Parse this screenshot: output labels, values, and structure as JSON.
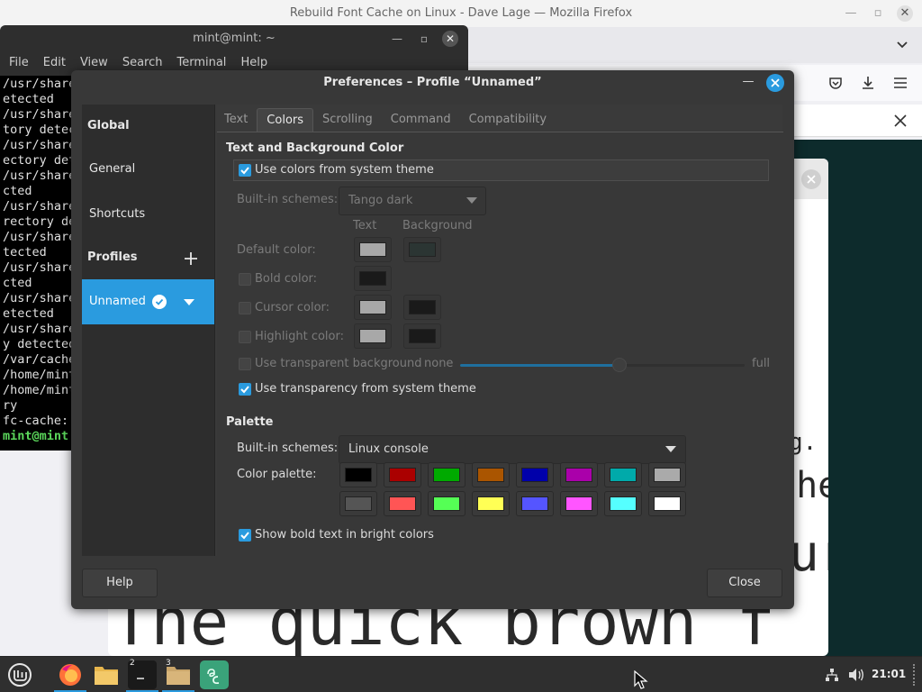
{
  "firefox": {
    "title": "Rebuild Font Cache on Linux - Dave Lage — Mozilla Firefox",
    "preview_lines": [
      "g.",
      "che",
      "ur",
      "The quick brown f"
    ]
  },
  "terminal": {
    "title": "mint@mint: ~",
    "menu": [
      "File",
      "Edit",
      "View",
      "Search",
      "Terminal",
      "Help"
    ],
    "lines": [
      "/usr/share",
      "etected",
      "/usr/share",
      "tory detec",
      "/usr/share",
      "ectory det",
      "/usr/share",
      "cted",
      "/usr/share",
      "rectory de",
      "/usr/share",
      "tected",
      "/usr/share",
      "cted",
      "/usr/share",
      "etected",
      "/usr/share",
      "y detected",
      "/var/cache",
      "/home/mint",
      "/home/mint",
      "ry",
      "fc-cache: "
    ],
    "prompt": "mint@mint"
  },
  "dialog": {
    "title": "Preferences – Profile “Unnamed”",
    "sidebar": {
      "global": "Global",
      "general": "General",
      "shortcuts": "Shortcuts",
      "profiles": "Profiles",
      "profile_name": "Unnamed"
    },
    "tabs": [
      "Text",
      "Colors",
      "Scrolling",
      "Command",
      "Compatibility"
    ],
    "active_tab": "Colors",
    "text_bg": {
      "heading": "Text and Background Color",
      "use_system_theme": "Use colors from system theme",
      "use_system_theme_checked": true,
      "builtin_label": "Built-in schemes:",
      "builtin_value": "Tango dark",
      "col_text": "Text",
      "col_background": "Background",
      "default_color": "Default color:",
      "bold_color": "Bold color:",
      "cursor_color": "Cursor color:",
      "highlight_color": "Highlight color:",
      "transparent_bg": "Use transparent background",
      "none": "none",
      "full": "full",
      "transparency_level": 0.56,
      "use_transparency_system": "Use transparency from system theme",
      "use_transparency_system_checked": true,
      "swatches": {
        "default_text": "#a8a8a8",
        "default_bg": "#2b3533",
        "bold_text": "#1a1a1a",
        "cursor_text": "#a8a8a8",
        "cursor_bg": "#1a1a1a",
        "highlight_text": "#a8a8a8",
        "highlight_bg": "#1a1a1a"
      }
    },
    "palette": {
      "heading": "Palette",
      "builtin_label": "Built-in schemes:",
      "builtin_value": "Linux console",
      "color_palette_label": "Color palette:",
      "row1": [
        "#000000",
        "#aa0000",
        "#00aa00",
        "#aa5500",
        "#0000aa",
        "#aa00aa",
        "#00aaaa",
        "#aaaaaa"
      ],
      "row2": [
        "#555555",
        "#ff5555",
        "#55ff55",
        "#ffff55",
        "#5555ff",
        "#ff55ff",
        "#55ffff",
        "#ffffff"
      ],
      "bold_bright": "Show bold text in bright colors",
      "bold_bright_checked": true
    },
    "buttons": {
      "help": "Help",
      "close": "Close"
    },
    "accent": "#2a9bdf"
  },
  "taskbar": {
    "workspace_terminal": "2",
    "workspace_files": "3",
    "clock": "21:01"
  }
}
